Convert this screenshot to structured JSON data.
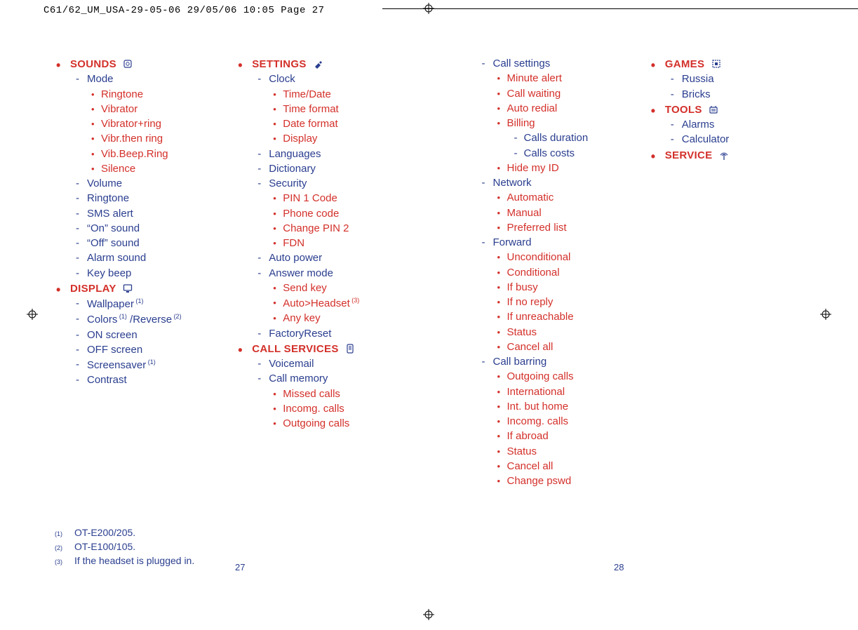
{
  "header_slug": "C61/62_UM_USA-29-05-06  29/05/06  10:05  Page 27",
  "page_left": "27",
  "page_right": "28",
  "footnotes": [
    {
      "num": "(1)",
      "text": "OT-E200/205."
    },
    {
      "num": "(2)",
      "text": "OT-E100/105."
    },
    {
      "num": "(3)",
      "text": "If the headset is plugged in."
    }
  ],
  "columns": [
    [
      {
        "level": 1,
        "text": "SOUNDS",
        "icon": "sounds-icon"
      },
      {
        "level": 2,
        "text": "Mode"
      },
      {
        "level": 3,
        "text": "Ringtone"
      },
      {
        "level": 3,
        "text": "Vibrator"
      },
      {
        "level": 3,
        "text": "Vibrator+ring"
      },
      {
        "level": 3,
        "text": "Vibr.then ring"
      },
      {
        "level": 3,
        "text": "Vib.Beep.Ring"
      },
      {
        "level": 3,
        "text": "Silence"
      },
      {
        "level": 2,
        "text": "Volume"
      },
      {
        "level": 2,
        "text": "Ringtone"
      },
      {
        "level": 2,
        "text": "SMS alert"
      },
      {
        "level": 2,
        "text": "“On” sound"
      },
      {
        "level": 2,
        "text": "“Off” sound"
      },
      {
        "level": 2,
        "text": "Alarm sound"
      },
      {
        "level": 2,
        "text": "Key beep"
      },
      {
        "level": 1,
        "text": "DISPLAY",
        "icon": "display-icon"
      },
      {
        "level": 2,
        "text": "Wallpaper",
        "sup": "(1)"
      },
      {
        "level": 2,
        "text": "Colors",
        "sup": "(1)",
        "tail": " /Reverse",
        "tail_sup": "(2)"
      },
      {
        "level": 2,
        "text": "ON screen"
      },
      {
        "level": 2,
        "text": "OFF screen"
      },
      {
        "level": 2,
        "text": "Screensaver",
        "sup": "(1)"
      },
      {
        "level": 2,
        "text": "Contrast"
      }
    ],
    [
      {
        "level": 1,
        "text": "SETTINGS",
        "icon": "settings-icon"
      },
      {
        "level": 2,
        "text": "Clock"
      },
      {
        "level": 3,
        "text": "Time/Date"
      },
      {
        "level": 3,
        "text": "Time format"
      },
      {
        "level": 3,
        "text": "Date format"
      },
      {
        "level": 3,
        "text": "Display"
      },
      {
        "level": 2,
        "text": "Languages"
      },
      {
        "level": 2,
        "text": "Dictionary"
      },
      {
        "level": 2,
        "text": "Security"
      },
      {
        "level": 3,
        "text": "PIN 1 Code"
      },
      {
        "level": 3,
        "text": "Phone code"
      },
      {
        "level": 3,
        "text": "Change PIN 2"
      },
      {
        "level": 3,
        "text": "FDN"
      },
      {
        "level": 2,
        "text": "Auto power"
      },
      {
        "level": 2,
        "text": "Answer mode"
      },
      {
        "level": 3,
        "text": "Send key"
      },
      {
        "level": 3,
        "text": "Auto>Headset",
        "sup": "(3)"
      },
      {
        "level": 3,
        "text": "Any key"
      },
      {
        "level": 2,
        "text": "FactoryReset"
      },
      {
        "level": 1,
        "text": "CALL SERVICES",
        "icon": "call-services-icon"
      },
      {
        "level": 2,
        "text": "Voicemail"
      },
      {
        "level": 2,
        "text": "Call memory"
      },
      {
        "level": 3,
        "text": "Missed calls"
      },
      {
        "level": 3,
        "text": "Incomg. calls"
      },
      {
        "level": 3,
        "text": "Outgoing calls"
      }
    ],
    [
      {
        "level": 2,
        "text": "Call settings"
      },
      {
        "level": 3,
        "text": "Minute alert"
      },
      {
        "level": 3,
        "text": "Call waiting"
      },
      {
        "level": 3,
        "text": "Auto redial"
      },
      {
        "level": 3,
        "text": "Billing"
      },
      {
        "level": 4,
        "text": "Calls duration"
      },
      {
        "level": 4,
        "text": "Calls costs"
      },
      {
        "level": 3,
        "text": "Hide my ID"
      },
      {
        "level": 2,
        "text": "Network"
      },
      {
        "level": 3,
        "text": "Automatic"
      },
      {
        "level": 3,
        "text": "Manual"
      },
      {
        "level": 3,
        "text": "Preferred list"
      },
      {
        "level": 2,
        "text": "Forward"
      },
      {
        "level": 3,
        "text": "Unconditional"
      },
      {
        "level": 3,
        "text": "Conditional"
      },
      {
        "level": 3,
        "text": "If busy"
      },
      {
        "level": 3,
        "text": "If no reply"
      },
      {
        "level": 3,
        "text": "If unreachable"
      },
      {
        "level": 3,
        "text": "Status"
      },
      {
        "level": 3,
        "text": "Cancel all"
      },
      {
        "level": 2,
        "text": "Call barring"
      },
      {
        "level": 3,
        "text": "Outgoing calls"
      },
      {
        "level": 3,
        "text": "International"
      },
      {
        "level": 3,
        "text": "Int. but home"
      },
      {
        "level": 3,
        "text": "Incomg. calls"
      },
      {
        "level": 3,
        "text": "If abroad"
      },
      {
        "level": 3,
        "text": "Status"
      },
      {
        "level": 3,
        "text": "Cancel all"
      },
      {
        "level": 3,
        "text": "Change pswd"
      }
    ],
    [
      {
        "level": 1,
        "text": "GAMES",
        "icon": "games-icon"
      },
      {
        "level": 2,
        "text": "Russia"
      },
      {
        "level": 2,
        "text": "Bricks"
      },
      {
        "level": 1,
        "text": "TOOLS",
        "icon": "tools-icon"
      },
      {
        "level": 2,
        "text": "Alarms"
      },
      {
        "level": 2,
        "text": "Calculator"
      },
      {
        "level": 1,
        "text": "SERVICE",
        "icon": "service-icon"
      }
    ]
  ]
}
